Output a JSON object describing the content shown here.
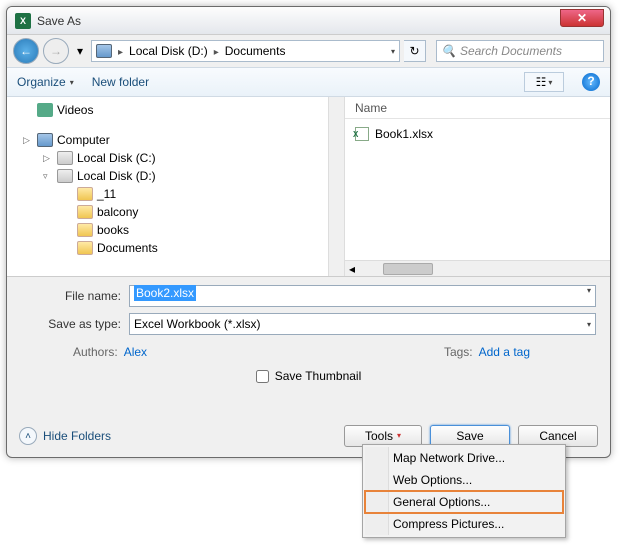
{
  "titlebar": {
    "title": "Save As",
    "close": "✕",
    "app_icon": "X"
  },
  "nav": {
    "back": "←",
    "fwd": "→",
    "history": "▾",
    "path": [
      "Local Disk (D:)",
      "Documents"
    ],
    "sep": "▸",
    "search_placeholder": "Search Documents",
    "refresh": "↻",
    "dropdown": "▾"
  },
  "toolbar": {
    "organize": "Organize",
    "newfolder": "New folder",
    "help": "?"
  },
  "tree": {
    "items": [
      {
        "level": "l1",
        "tri": "",
        "ico": "ico-video",
        "label": "Videos"
      },
      {
        "level": "l1",
        "tri": "▷",
        "ico": "ico-computer",
        "label": "Computer"
      },
      {
        "level": "l2",
        "tri": "▷",
        "ico": "ico-drive",
        "label": "Local Disk (C:)"
      },
      {
        "level": "l2",
        "tri": "▿",
        "ico": "ico-drive",
        "label": "Local Disk (D:)"
      },
      {
        "level": "l3",
        "tri": "",
        "ico": "ico-folder",
        "label": "_11"
      },
      {
        "level": "l3",
        "tri": "",
        "ico": "ico-folder",
        "label": "balcony"
      },
      {
        "level": "l3",
        "tri": "",
        "ico": "ico-folder",
        "label": "books"
      },
      {
        "level": "l3",
        "tri": "",
        "ico": "ico-folder",
        "label": "Documents"
      }
    ]
  },
  "filepane": {
    "header_name": "Name",
    "items": [
      {
        "name": "Book1.xlsx"
      }
    ]
  },
  "form": {
    "filename_label": "File name:",
    "filename_value": "Book2.xlsx",
    "type_label": "Save as type:",
    "type_value": "Excel Workbook (*.xlsx)",
    "authors_label": "Authors:",
    "authors_value": "Alex",
    "tags_label": "Tags:",
    "tags_value": "Add a tag",
    "thumb_label": "Save Thumbnail"
  },
  "footer": {
    "hide": "Hide Folders",
    "hide_icon": "˄",
    "tools": "Tools",
    "save": "Save",
    "cancel": "Cancel"
  },
  "tools_menu": {
    "items": [
      {
        "label": "Map Network Drive...",
        "hi": false
      },
      {
        "label": "Web Options...",
        "hi": false
      },
      {
        "label": "General Options...",
        "hi": true
      },
      {
        "label": "Compress Pictures...",
        "hi": false
      }
    ]
  }
}
